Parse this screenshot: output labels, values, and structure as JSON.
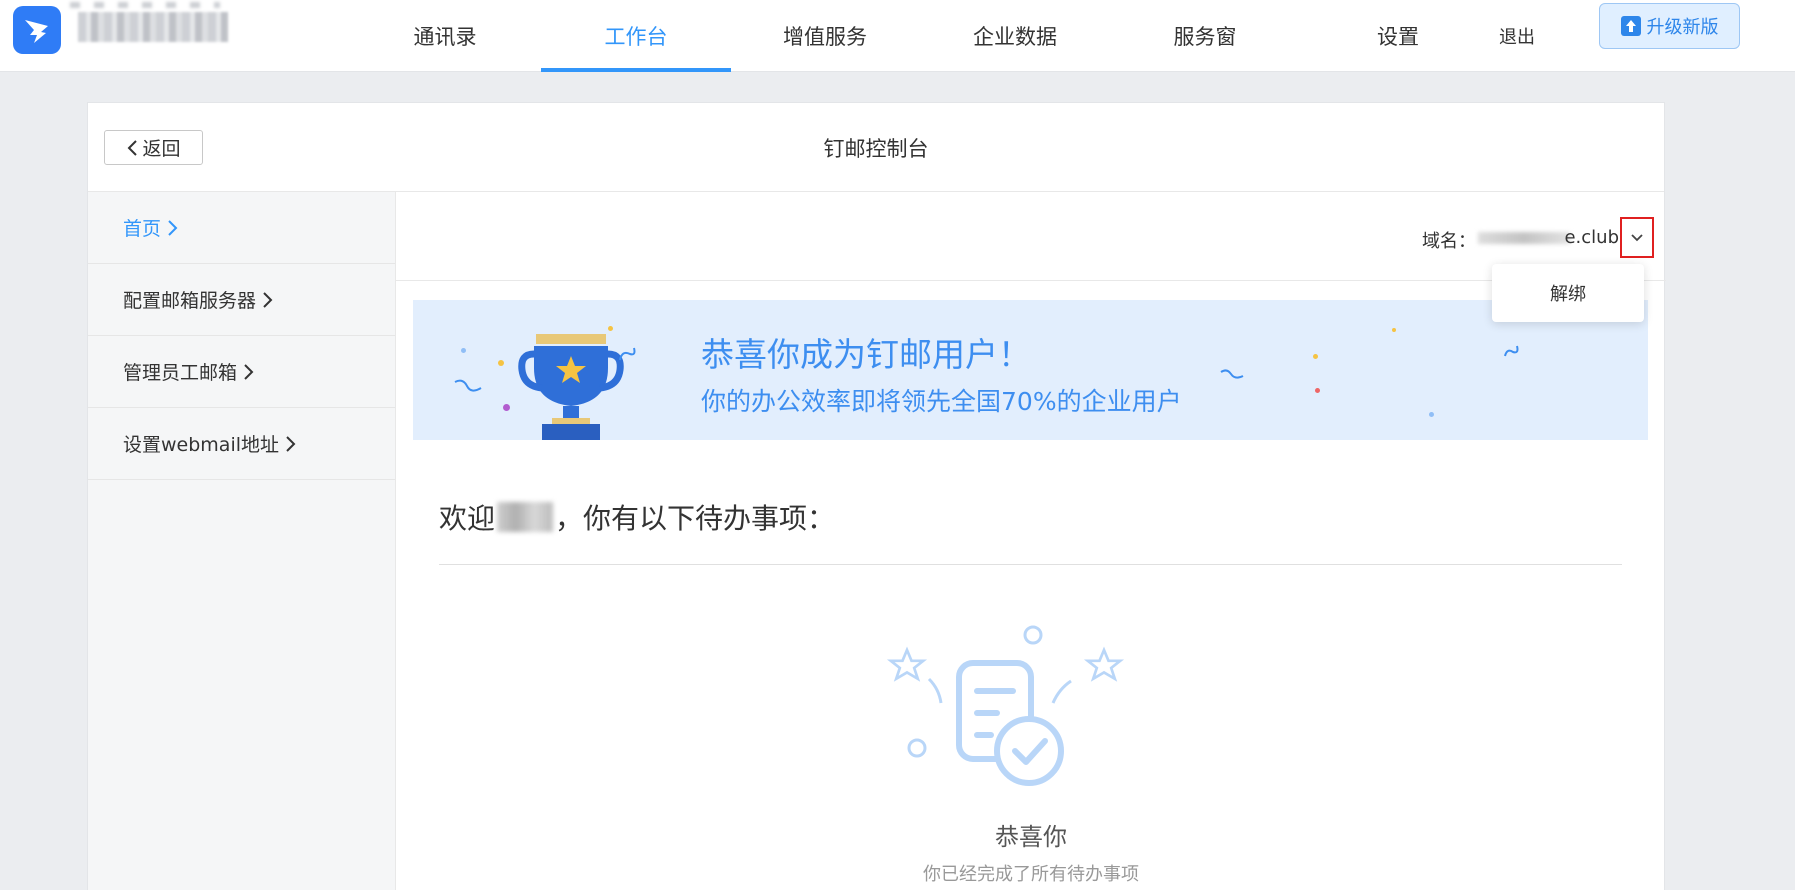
{
  "nav": {
    "items": [
      "通讯录",
      "工作台",
      "增值服务",
      "企业数据",
      "服务窗",
      "设置"
    ],
    "logout": "退出",
    "upgrade": "升级新版"
  },
  "header": {
    "back": "返回",
    "title": "钉邮控制台"
  },
  "sidebar": {
    "items": [
      {
        "label": "首页",
        "active": true
      },
      {
        "label": "配置邮箱服务器",
        "active": false
      },
      {
        "label": "管理员工邮箱",
        "active": false
      },
      {
        "label": "设置webmail地址",
        "active": false
      }
    ]
  },
  "domain": {
    "label": "域名：",
    "value": "e.club",
    "menu": [
      "解绑"
    ]
  },
  "banner": {
    "title": "恭喜你成为钉邮用户！",
    "subtitle": "你的办公效率即将领先全国70%的企业用户"
  },
  "welcome": {
    "prefix": "欢迎",
    "suffix": "，你有以下待办事项："
  },
  "empty": {
    "title": "恭喜你",
    "subtitle": "你已经完成了所有待办事项"
  },
  "colors": {
    "accent": "#3296fa",
    "highlight_border": "#e02020"
  },
  "icons": {
    "logo": "dingtalk-logo-icon",
    "upgrade": "upload-arrow-icon",
    "back": "chevron-left-icon",
    "sidebar_arrow": "chevron-right-icon",
    "dropdown": "chevron-down-icon",
    "banner": "trophy-icon",
    "empty": "clipboard-check-icon"
  }
}
